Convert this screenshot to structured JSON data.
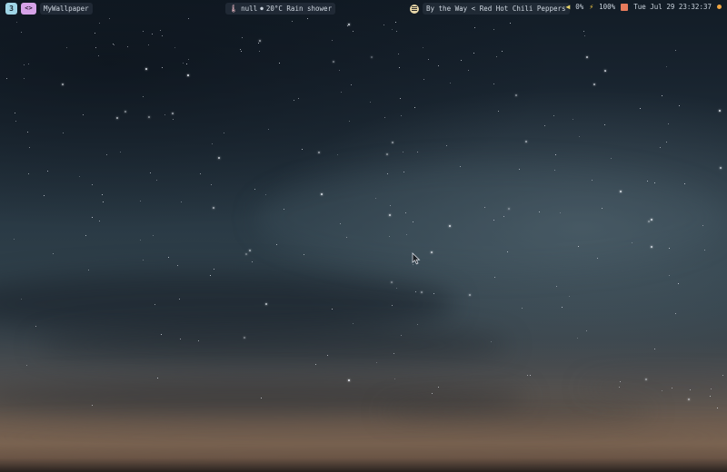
{
  "workspace": {
    "number": "3",
    "app_icon": "code-brackets-icon",
    "app_icon_glyph": "<>",
    "window_title": "MyWallpaper"
  },
  "status": {
    "temperature_icon": "thermometer-icon",
    "temperature_value": "null",
    "separator": "●",
    "weather": "20°C Rain shower"
  },
  "media": {
    "icon": "spotify-icon",
    "track": "By the Way < Red Hot Chili Peppers"
  },
  "system": {
    "volume_icon": "speaker-icon",
    "volume": "0%",
    "battery_icon": "lightning-icon",
    "battery": "100%",
    "calendar_icon": "calendar-icon",
    "datetime": "Tue Jul 29 23:32:37",
    "power_icon": "power-dot-icon"
  },
  "colors": {
    "workspace_accent": "#9fd5e6",
    "app_accent": "#d6a2e8",
    "volume_accent": "#e6d36a",
    "battery_accent": "#f2c744",
    "calendar_accent": "#e77b5c",
    "power_accent": "#f0a642"
  }
}
